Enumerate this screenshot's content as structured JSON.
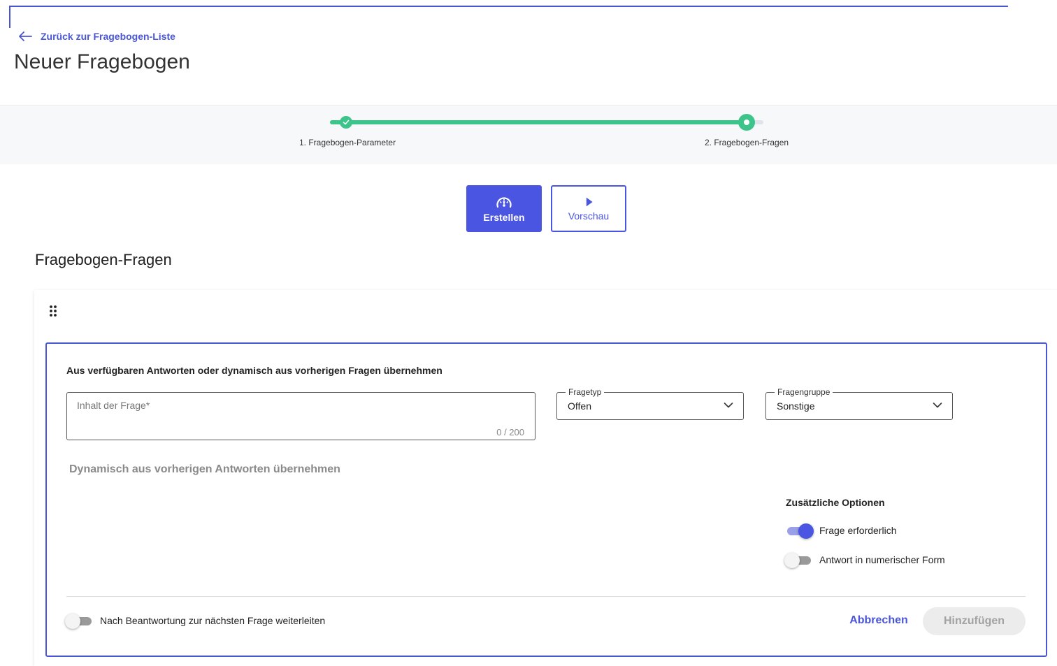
{
  "header": {
    "back_label": "Zurück zur Fragebogen-Liste",
    "title": "Neuer Fragebogen"
  },
  "stepper": {
    "progress_percent": 100,
    "steps": [
      {
        "label": "1. Fragebogen-Parameter",
        "status": "completed"
      },
      {
        "label": "2. Fragebogen-Fragen",
        "status": "current"
      }
    ],
    "color": "#3cc48a"
  },
  "mode_buttons": {
    "create_label": "Erstellen",
    "create_icon": "gauge-icon",
    "preview_label": "Vorschau",
    "preview_icon": "play-icon"
  },
  "section": {
    "title": "Fragebogen-Fragen"
  },
  "editor": {
    "heading": "Aus verfügbaren Antworten oder dynamisch aus vorherigen Fragen übernehmen",
    "question_placeholder": "Inhalt der Frage*",
    "question_value": "",
    "question_counter": "0 / 200",
    "question_type": {
      "label": "Fragetyp",
      "value": "Offen"
    },
    "question_group": {
      "label": "Fragengruppe",
      "value": "Sonstige"
    },
    "dynamic_label": "Dynamisch aus vorherigen Antworten übernehmen",
    "options": {
      "title": "Zusätzliche Optionen",
      "items": [
        {
          "label": "Frage erforderlich",
          "on": true
        },
        {
          "label": "Antwort in numerischer Form",
          "on": false
        }
      ]
    },
    "forward": {
      "label": "Nach Beantwortung zur nächsten Frage weiterleiten",
      "on": false
    },
    "cancel_label": "Abbrechen",
    "add_label": "Hinzufügen"
  },
  "colors": {
    "accent": "#4a56e2",
    "success": "#3cc48a",
    "disabled": "#ececec"
  }
}
